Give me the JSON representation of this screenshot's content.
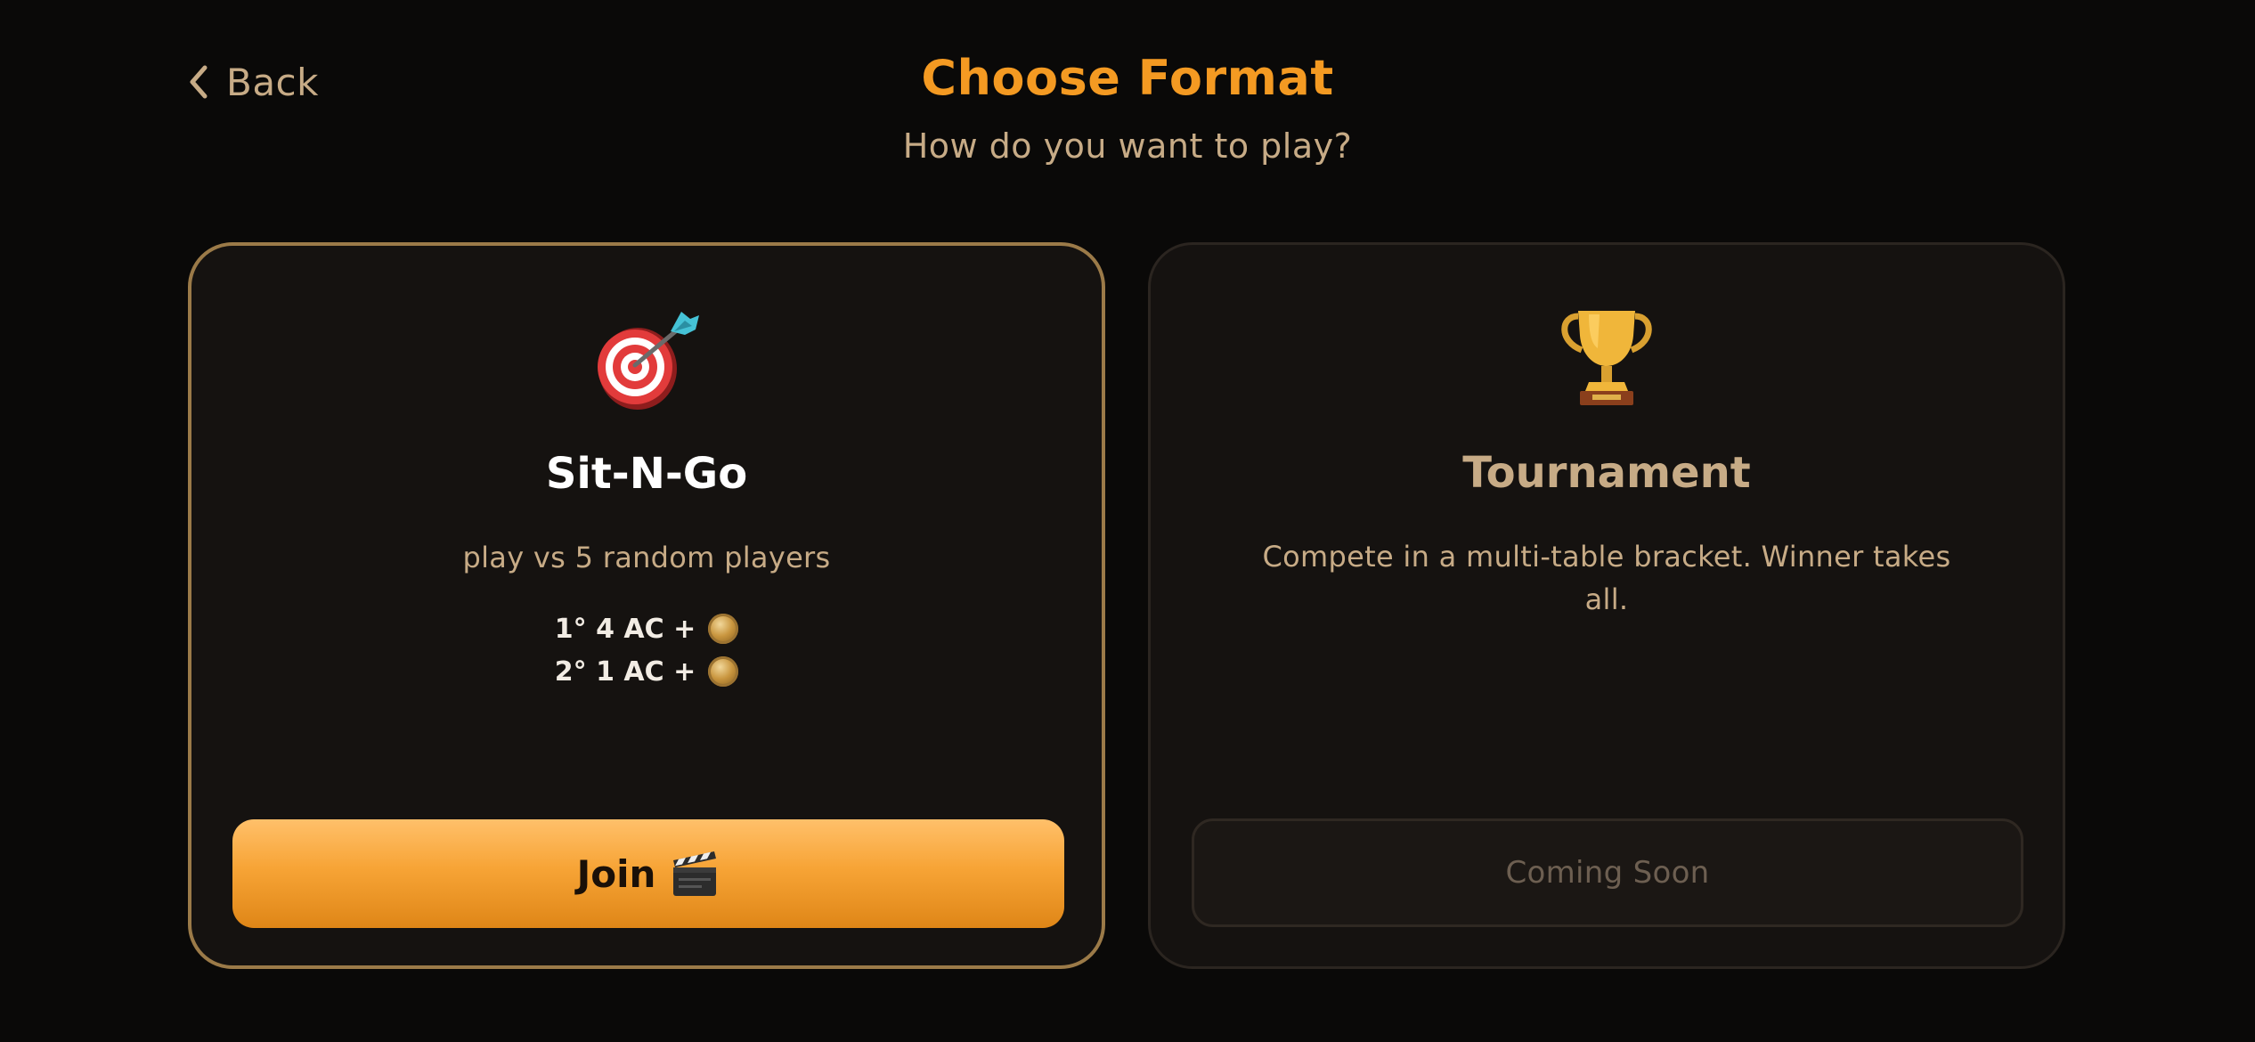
{
  "header": {
    "back_label": "Back",
    "title": "Choose Format",
    "subtitle": "How do you want to play?"
  },
  "cards": {
    "sit_n_go": {
      "icon": "dart-target-icon",
      "title": "Sit-N-Go",
      "description": "play vs 5 random players",
      "prizes": [
        {
          "label": "1° 4 AC +",
          "icon": "coin-icon"
        },
        {
          "label": "2° 1 AC +",
          "icon": "coin-icon"
        }
      ],
      "button_label": "Join",
      "button_icon": "clapper-board-icon"
    },
    "tournament": {
      "icon": "trophy-icon",
      "title": "Tournament",
      "description": "Compete in a multi-table bracket. Winner takes all.",
      "button_label": "Coming Soon"
    }
  },
  "colors": {
    "background": "#0a0908",
    "accent": "#f49a22",
    "muted_text": "#c7ab86",
    "card_bg": "#151210",
    "selected_border": "#9b7a48"
  }
}
